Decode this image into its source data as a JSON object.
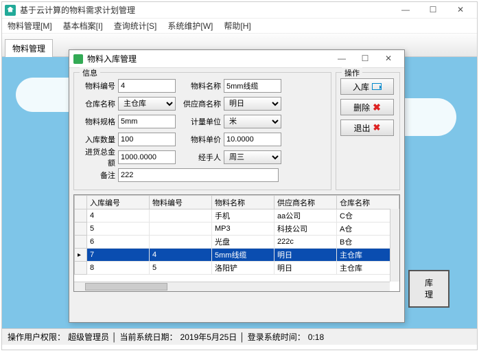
{
  "main": {
    "title": "基于云计算的物料需求计划管理"
  },
  "menu": [
    "物料管理[M]",
    "基本档案[I]",
    "查询统计[S]",
    "系统维护[W]",
    "帮助[H]"
  ],
  "tab": "物料管理",
  "bigBtn": {
    "l1": "库",
    "l2": "理"
  },
  "status": {
    "role_lbl": "操作用户权限：",
    "role": "超级管理员",
    "date_lbl": "当前系统日期：",
    "date": "2019年5月25日",
    "login_lbl": "登录系统时间：",
    "login": "0:18"
  },
  "dlg": {
    "title": "物料入库管理",
    "info_lbl": "信息",
    "op_lbl": "操作",
    "fields": {
      "mid_lbl": "物料编号",
      "mid": "4",
      "mname_lbl": "物料名称",
      "mname": "5mm线缆",
      "wh_lbl": "仓库名称",
      "wh": "主仓库",
      "sup_lbl": "供应商名称",
      "sup": "明日",
      "spec_lbl": "物料规格",
      "spec": "5mm",
      "unit_lbl": "计量单位",
      "unit": "米",
      "qty_lbl": "入库数量",
      "qty": "100",
      "price_lbl": "物料单价",
      "price": "10.0000",
      "total_lbl": "进货总金额",
      "total": "1000.0000",
      "handler_lbl": "经手人",
      "handler": "周三",
      "note_lbl": "备注",
      "note": "222"
    },
    "ops": {
      "in": "入库",
      "del": "删除",
      "exit": "退出"
    },
    "cols": [
      "入库编号",
      "物料编号",
      "物料名称",
      "供应商名称",
      "仓库名称"
    ],
    "rows": [
      {
        "rid": "4",
        "mid": "",
        "mname": "手机",
        "sup": "aa公司",
        "wh": "C仓"
      },
      {
        "rid": "5",
        "mid": "",
        "mname": "MP3",
        "sup": "科技公司",
        "wh": "A仓"
      },
      {
        "rid": "6",
        "mid": "",
        "mname": "光盘",
        "sup": "222c",
        "wh": "B仓"
      },
      {
        "rid": "7",
        "mid": "4",
        "mname": "5mm线缆",
        "sup": "明日",
        "wh": "主仓库"
      },
      {
        "rid": "8",
        "mid": "5",
        "mname": "洛阳铲",
        "sup": "明日",
        "wh": "主仓库"
      }
    ],
    "sel": 3
  }
}
